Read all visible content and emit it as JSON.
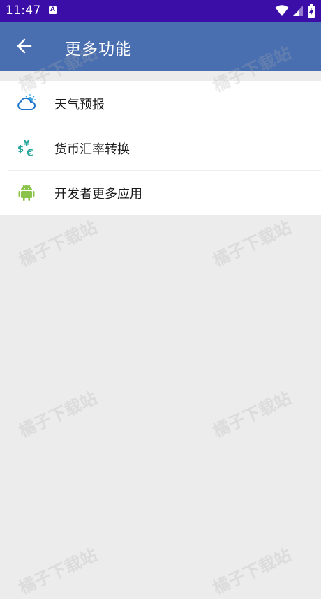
{
  "status": {
    "time": "11:47",
    "notification_icon": "A"
  },
  "appbar": {
    "title": "更多功能",
    "back_icon": "arrow-left-icon"
  },
  "menu": {
    "items": [
      {
        "label": "天气预报",
        "icon": "weather-cloud-icon"
      },
      {
        "label": "货币汇率转换",
        "icon": "currency-exchange-icon"
      },
      {
        "label": "开发者更多应用",
        "icon": "android-icon"
      }
    ]
  },
  "watermark": "橘子下载站",
  "colors": {
    "statusbar": "#3c0ea8",
    "appbar": "#4a6fb1",
    "background": "#ececec",
    "surface": "#ffffff"
  }
}
